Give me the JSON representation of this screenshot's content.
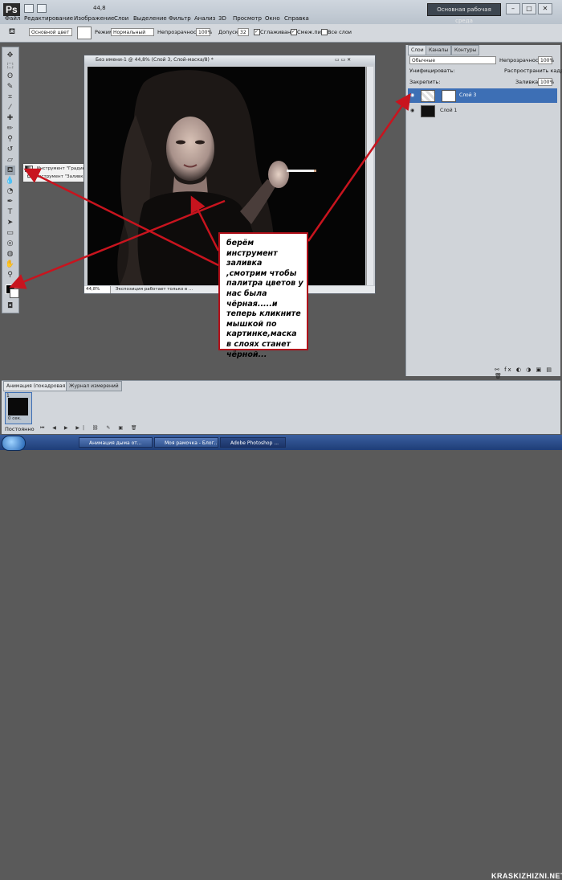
{
  "app": {
    "logo": "Ps",
    "menu": [
      "Файл",
      "Редактирование",
      "Изображение",
      "Слои",
      "Выделение",
      "Фильтр",
      "Анализ",
      "3D",
      "Просмотр",
      "Окно",
      "Справка"
    ],
    "zoom": "44,8",
    "workspace_button": "Основная рабочая среда",
    "window_buttons": [
      "–",
      "□",
      "✕"
    ]
  },
  "options_bar": {
    "fill_source": "Основной цвет",
    "mode_label": "Режим:",
    "mode_value": "Нормальный",
    "opacity_label": "Непрозрачность:",
    "opacity_value": "100%",
    "tolerance_label": "Допуск:",
    "tolerance_value": "32",
    "antialias": "Сглаживание",
    "contiguous": "Смеж.пикс",
    "all_layers": "Все слои"
  },
  "tool_flyout": {
    "items": [
      {
        "label": "Инструмент \"Градиент\"",
        "key": "G"
      },
      {
        "label": "Инструмент \"Заливка\"",
        "key": "G"
      }
    ]
  },
  "document": {
    "title": "Без имени-1 @ 44,8% (Слой 3, Слой-маска/8) *",
    "zoom": "44,8%",
    "status": "Экспозиция работает только в ..."
  },
  "layers_panel": {
    "tabs": [
      "Слои",
      "Каналы",
      "Контуры"
    ],
    "blend_mode": "Обычные",
    "opacity_label": "Непрозрачность:",
    "opacity_value": "100%",
    "unify_label": "Унифицировать:",
    "propagate_label": "Распространить кадр 1",
    "lock_label": "Закрепить:",
    "fill_label": "Заливка:",
    "fill_value": "100%",
    "layers": [
      {
        "name": "Слой 3",
        "selected": true
      },
      {
        "name": "Слой 1",
        "selected": false
      }
    ]
  },
  "animation_panel": {
    "tabs": [
      "Анимация (покадровая)",
      "Журнал измерений"
    ],
    "frame_number": "1",
    "frame_time": "0 сек.",
    "loop": "Постоянно"
  },
  "taskbar": {
    "tasks": [
      "Анимация дыма от...",
      "Моя рамочка - Блог...",
      "Adobe Photoshop ..."
    ]
  },
  "note": {
    "text": "берём инструмент заливка ,смотрим чтобы палитра цветов у нас была чёрная.....и теперь кликните мышкой по картинке,маска в слоях станет чёрной..."
  },
  "watermark": "KRASKIZHIZNI.NET",
  "colors": {
    "arrow": "#c8141e",
    "selected_layer": "#3d6fb5",
    "canvas": "#050505"
  }
}
